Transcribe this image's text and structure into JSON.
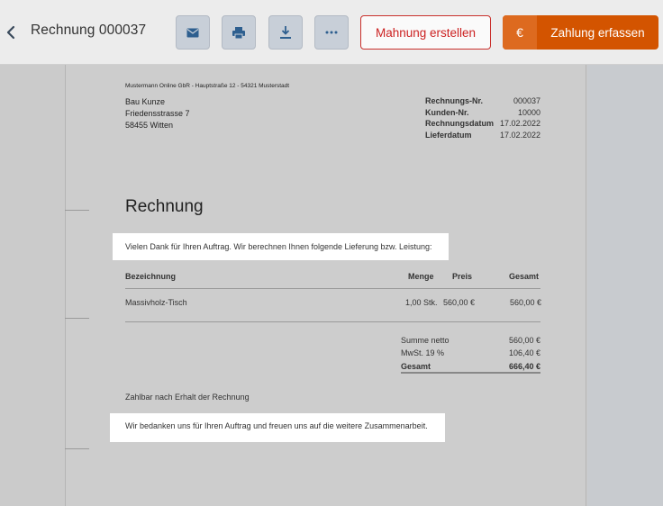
{
  "header": {
    "title": "Rechnung 000037",
    "dunning_label": "Mahnung erstellen",
    "pay_symbol": "€",
    "pay_label": "Zahlung erfassen"
  },
  "icons": {
    "back": "chevron-left-icon",
    "mail": "envelope-icon",
    "print": "printer-icon",
    "download": "download-icon",
    "more": "more-dots-icon"
  },
  "colors": {
    "accent": "#d35400",
    "danger": "#c9302c"
  },
  "invoice": {
    "sender_line": "Mustermann Online GbR - Hauptstraße 12 - 54321 Musterstadt",
    "recipient": [
      "Bau Kunze",
      "Friedensstrasse 7",
      "58455 Witten"
    ],
    "meta": [
      {
        "label": "Rechnungs-Nr.",
        "value": "000037"
      },
      {
        "label": "Kunden-Nr.",
        "value": "10000"
      },
      {
        "label": "Rechnungsdatum",
        "value": "17.02.2022"
      },
      {
        "label": "Lieferdatum",
        "value": "17.02.2022"
      }
    ],
    "heading": "Rechnung",
    "intro": "Vielen Dank für Ihren Auftrag. Wir berechnen Ihnen folgende Lieferung bzw. Leistung:",
    "columns": {
      "description": "Bezeichnung",
      "quantity": "Menge",
      "price": "Preis",
      "total": "Gesamt"
    },
    "items": [
      {
        "description": "Massivholz-Tisch",
        "quantity": "1,00 Stk.",
        "price": "560,00 €",
        "total": "560,00 €"
      }
    ],
    "totals": {
      "net_label": "Summe netto",
      "net_value": "560,00 €",
      "vat_label": "MwSt. 19 %",
      "vat_value": "106,40 €",
      "gross_label": "Gesamt",
      "gross_value": "666,40 €"
    },
    "payment_terms": "Zahlbar nach Erhalt der Rechnung",
    "closing": "Wir bedanken uns für Ihren Auftrag und freuen uns auf die weitere Zusammenarbeit."
  }
}
